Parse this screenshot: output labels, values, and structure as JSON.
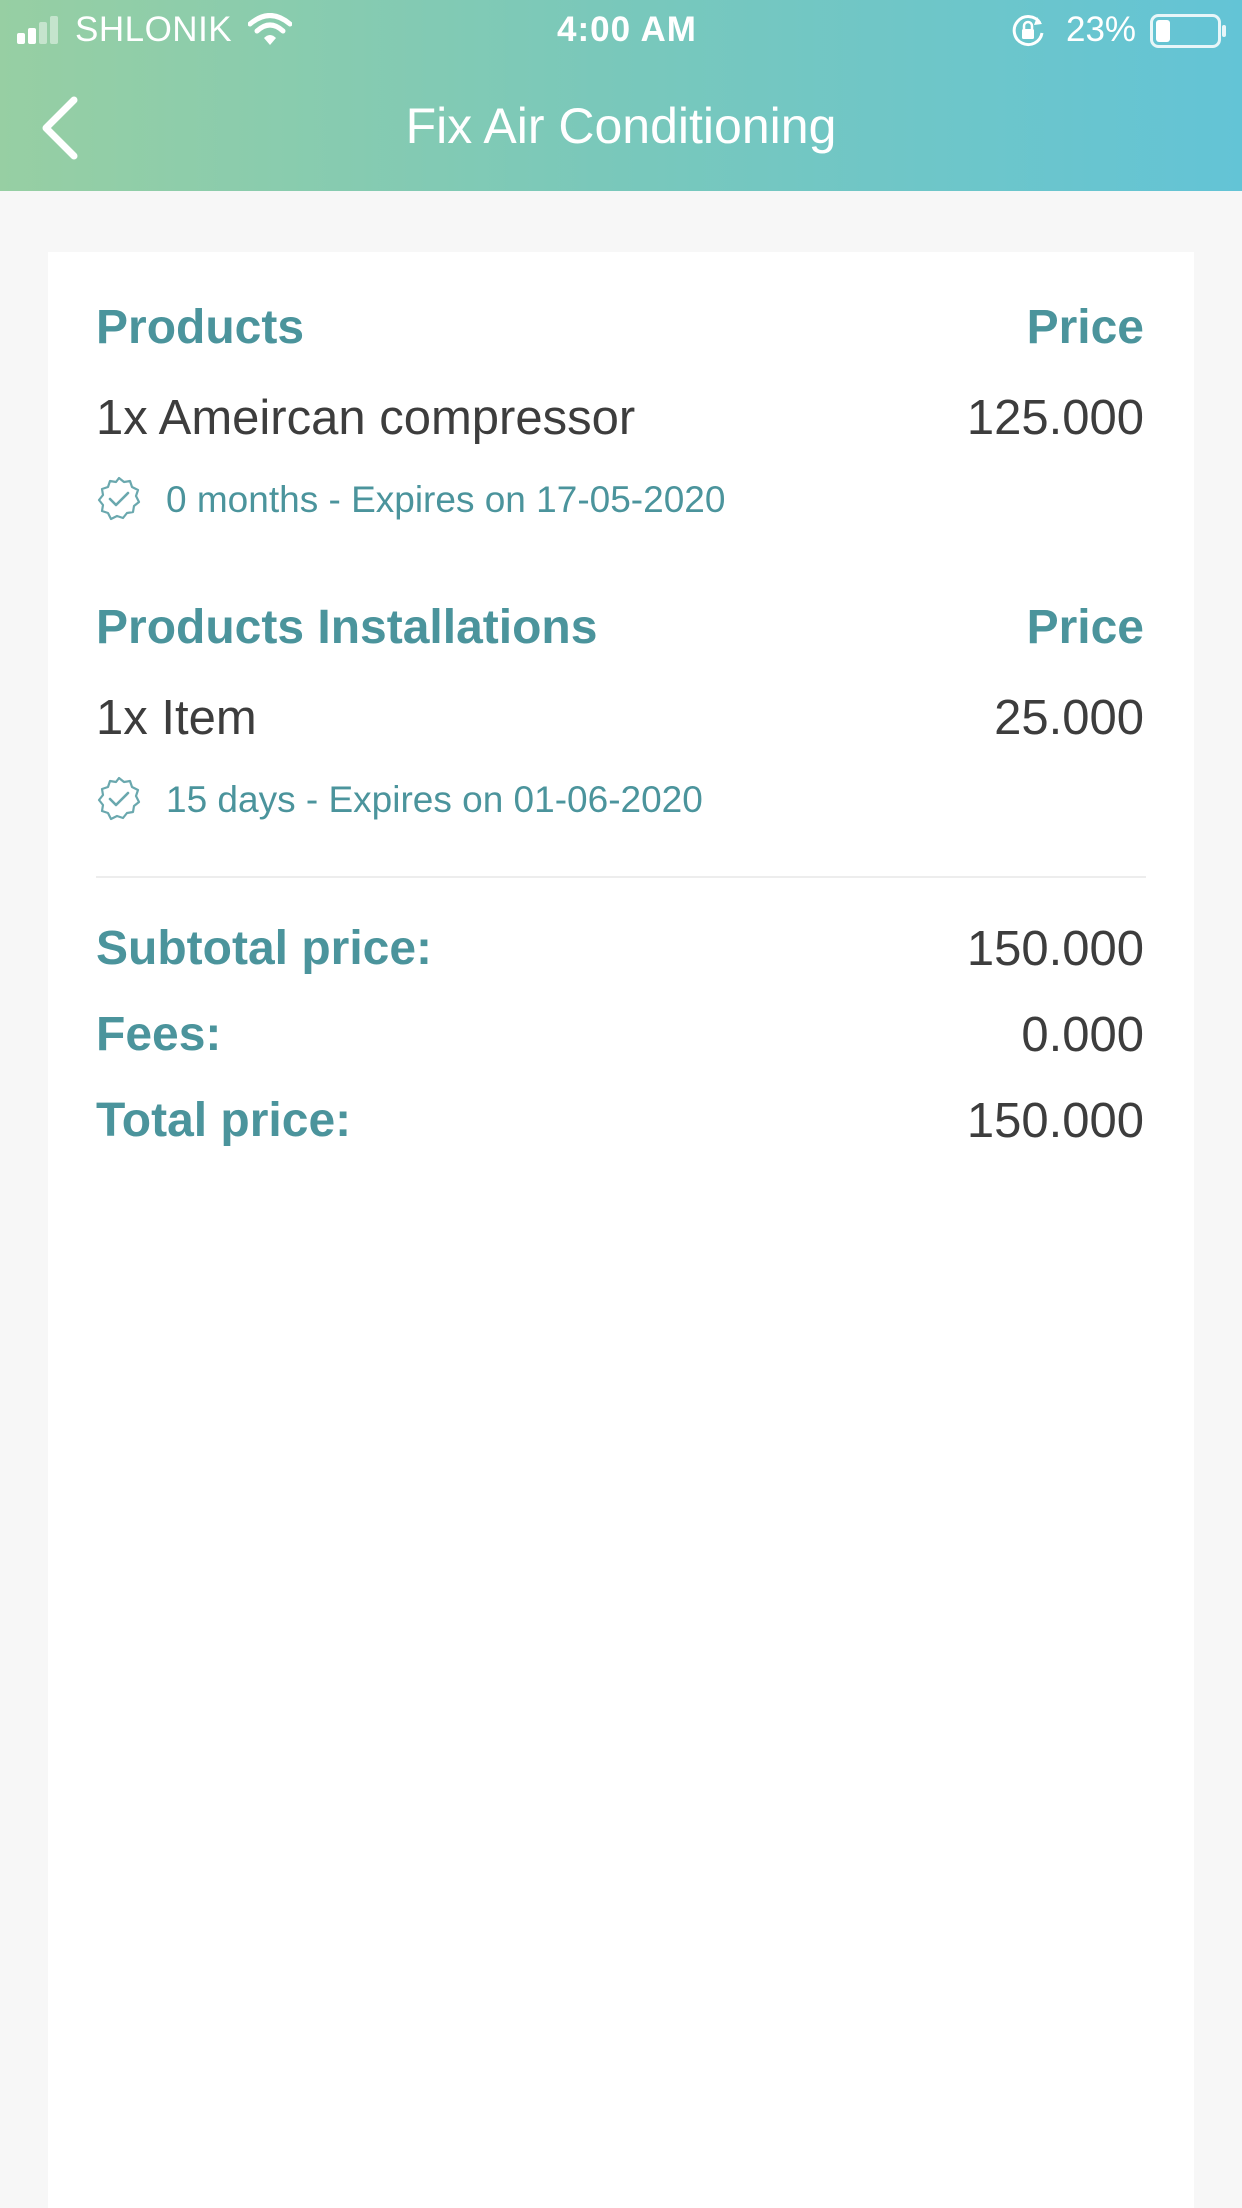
{
  "status_bar": {
    "carrier": "SHLONIK",
    "time": "4:00 AM",
    "battery_percent": "23%",
    "icons": [
      "signal-icon",
      "wifi-icon",
      "orientation-lock-icon",
      "battery-icon"
    ]
  },
  "header": {
    "title": "Fix Air Conditioning",
    "back_icon": "chevron-left-icon"
  },
  "colors": {
    "header_gradient": [
      "#97cfa3",
      "#79c8bb",
      "#63c4d6"
    ],
    "accent": "#4b949c",
    "text": "#3d3d3d",
    "background": "#f7f7f7",
    "card": "#ffffff"
  },
  "products": {
    "heading": "Products",
    "price_heading": "Price",
    "items": [
      {
        "name": "1x Ameircan compressor",
        "price": "125.000",
        "warranty": "0 months - Expires on 17-05-2020"
      }
    ]
  },
  "installations": {
    "heading": "Products Installations",
    "price_heading": "Price",
    "items": [
      {
        "name": "1x Item",
        "price": "25.000",
        "warranty": "15 days - Expires on 01-06-2020"
      }
    ]
  },
  "summary": {
    "subtotal_label": "Subtotal price:",
    "subtotal_value": "150.000",
    "fees_label": "Fees:",
    "fees_value": "0.000",
    "total_label": "Total price:",
    "total_value": "150.000"
  }
}
